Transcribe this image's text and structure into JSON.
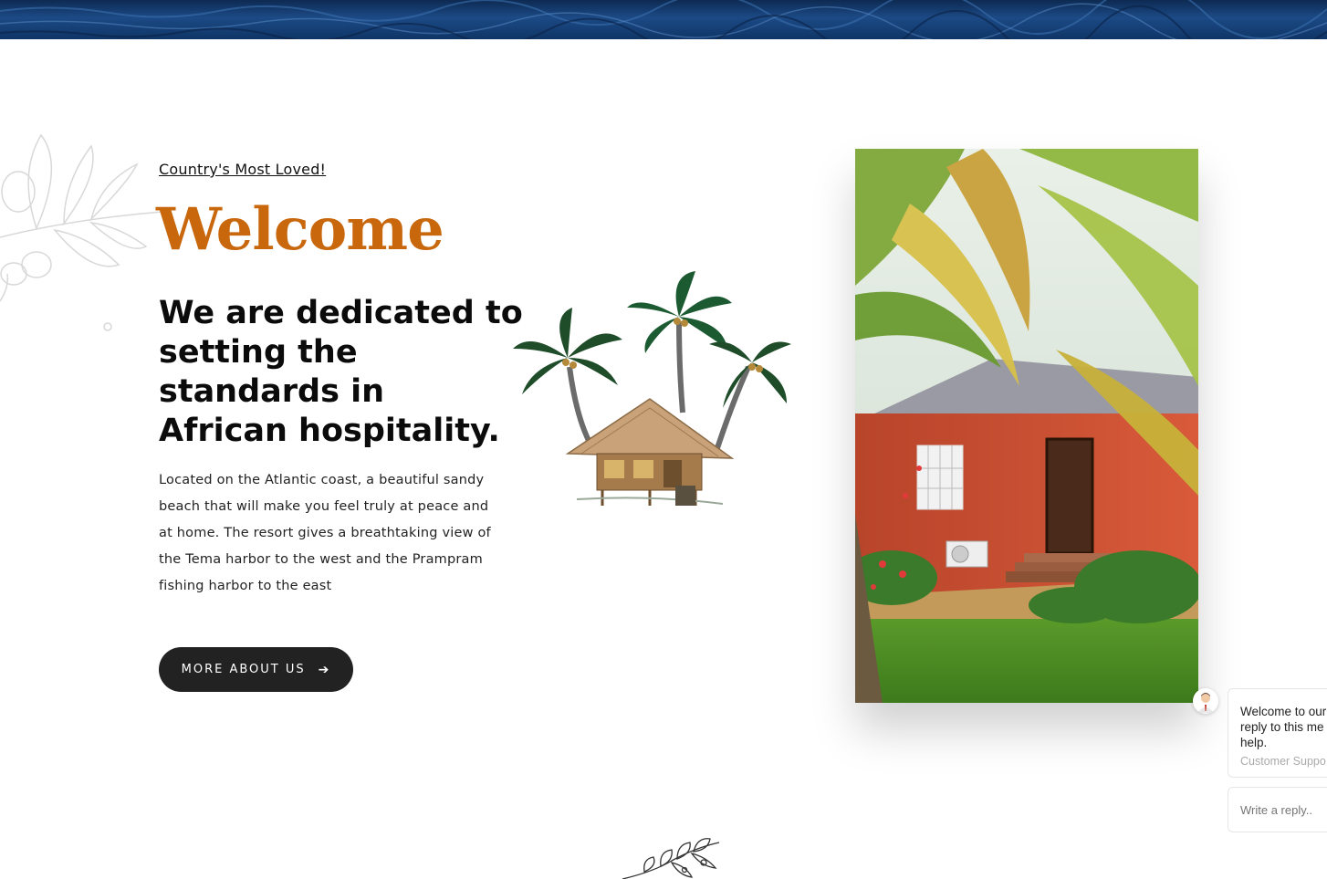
{
  "welcome_section": {
    "tagline": "Country's Most Loved!",
    "title": "Welcome",
    "headline": "We are dedicated to setting the standards in African hospitality.",
    "description": "Located on the Atlantic coast, a beautiful sandy beach that will make you feel truly at peace and at home. The resort gives a breathtaking view of the Tema harbor to the west and the Prampram fishing harbor to the east",
    "button_label": "MORE ABOUT US",
    "button_icon": "arrow-right-icon"
  },
  "chat_widget": {
    "message": "Welcome to our\nreply to this me\nhelp.",
    "sender": "Customer Suppo",
    "reply_placeholder": "Write a reply.."
  },
  "colors": {
    "accent": "#c8670c",
    "button_bg": "#222222",
    "banner": "#1c4a86"
  }
}
